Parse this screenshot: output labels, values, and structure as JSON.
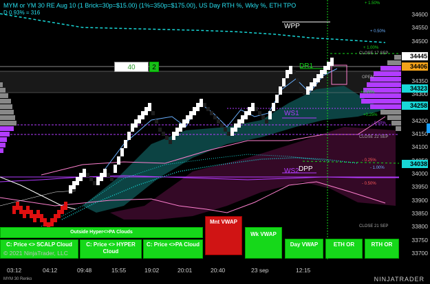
{
  "header": {
    "title": "MYM or YM 30 RE Aug 10 (1 Brick=30p=$15.00) (1%=350p=$175.00), US Day RTH %, Wkly %, ETH TPO",
    "subtitle": "D 0.93% = 316"
  },
  "price_axis": {
    "ticks": [
      "34600",
      "34550",
      "34500",
      "34450",
      "34400",
      "34350",
      "34300",
      "34250",
      "34200",
      "34150",
      "34100",
      "34050",
      "34000",
      "33950",
      "33900",
      "33850",
      "33800",
      "33750",
      "33700"
    ],
    "boxes": [
      {
        "label": "34445",
        "color": "#ffffff"
      },
      {
        "label": "34406",
        "color": "#f3a21a"
      },
      {
        "label": "34323",
        "color": "#18d8d8"
      },
      {
        "label": "34258",
        "color": "#18d8d8"
      },
      {
        "label": "34038",
        "color": "#18d8d8"
      }
    ]
  },
  "time_axis": [
    "03:12",
    "04:12",
    "09:48",
    "15:55",
    "19:02",
    "20:01",
    "20:40",
    "23 sep",
    "12:15"
  ],
  "levels": {
    "wpp": "WPP",
    "dr1": "DR1",
    "ws1": "WS1",
    "ws2": "WS2",
    "dpp": "DPP",
    "close17": "CLOSE 17 SEP",
    "close22": "CLOSE 22 SEP",
    "close21": "CLOSE 21 SEP",
    "open": "OPEN",
    "p150": "+ 1.50%",
    "p100": "+ 1.00%",
    "p050": "+ 0.50%",
    "p090": "+0.90%",
    "p025": "+0.25%",
    "m050a": "- 0.50%",
    "m025": "- 0.25%",
    "m100": "- 1.00%",
    "m050b": "- 0.50%"
  },
  "order_qty": {
    "value": "40",
    "button": "2"
  },
  "buttons": {
    "hyper_clouds": "Outside Hyper<>PA Clouds",
    "scalp": "C: Price <> SCALP Cloud",
    "hyper": "C: Price <> HYPER Cloud",
    "pa": "C: Price <>PA Cloud",
    "mnt_vwap": "Mnt VWAP",
    "wk_vwap": "Wk VWAP",
    "day_vwap": "Day VWAP",
    "eth_or": "ETH OR",
    "rth_or": "RTH OR"
  },
  "copyright": "© 2021 NinjaTrader, LLC",
  "footer_label": "MYM 30 Renko",
  "brand": "NINJATRADER",
  "colors": {
    "up_brick": "#ffffff",
    "down_brick": "#222222",
    "cyan": "#18d8d8",
    "magenta": "#b23cff",
    "pink": "#ff80d0",
    "green": "#16d81a"
  }
}
